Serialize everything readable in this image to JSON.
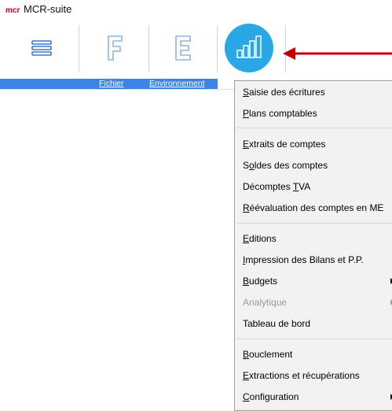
{
  "app": {
    "title": "MCR-suite",
    "logo_text": "mcr"
  },
  "toolbar": {
    "buttons": [
      {
        "icon": "hamburger-menu-icon"
      },
      {
        "icon": "letter-f-icon",
        "label": "Fichier"
      },
      {
        "icon": "letter-e-icon",
        "label": "Environnement"
      },
      {
        "icon": "bar-chart-icon",
        "accent": "#2aa8e6"
      }
    ]
  },
  "menu": {
    "items": [
      {
        "label": "Saisie des écritures",
        "mnemonic": "S"
      },
      {
        "label": "Plans comptables",
        "mnemonic": "P"
      },
      {
        "label": "Extraits de comptes",
        "mnemonic": "E"
      },
      {
        "label": "Soldes des comptes",
        "mnemonic": "o"
      },
      {
        "label": "Décomptes TVA",
        "mnemonic": "T"
      },
      {
        "label": "Réévaluation des comptes en ME",
        "mnemonic": "R"
      },
      {
        "label": "Editions",
        "mnemonic": "E"
      },
      {
        "label": "Impression des Bilans et P.P.",
        "mnemonic": "I"
      },
      {
        "label": "Budgets",
        "mnemonic": "B",
        "submenu": true
      },
      {
        "label": "Analytique",
        "disabled": true,
        "submenu": true
      },
      {
        "label": "Tableau de bord"
      },
      {
        "label": "Bouclement",
        "mnemonic": "B"
      },
      {
        "label": "Extractions et récupérations",
        "mnemonic": "E"
      },
      {
        "label": "Configuration",
        "mnemonic": "C",
        "submenu": true
      }
    ]
  },
  "colors": {
    "strip": "#3d84e6",
    "arrow": "#c00000",
    "accent": "#2aa8e6"
  }
}
